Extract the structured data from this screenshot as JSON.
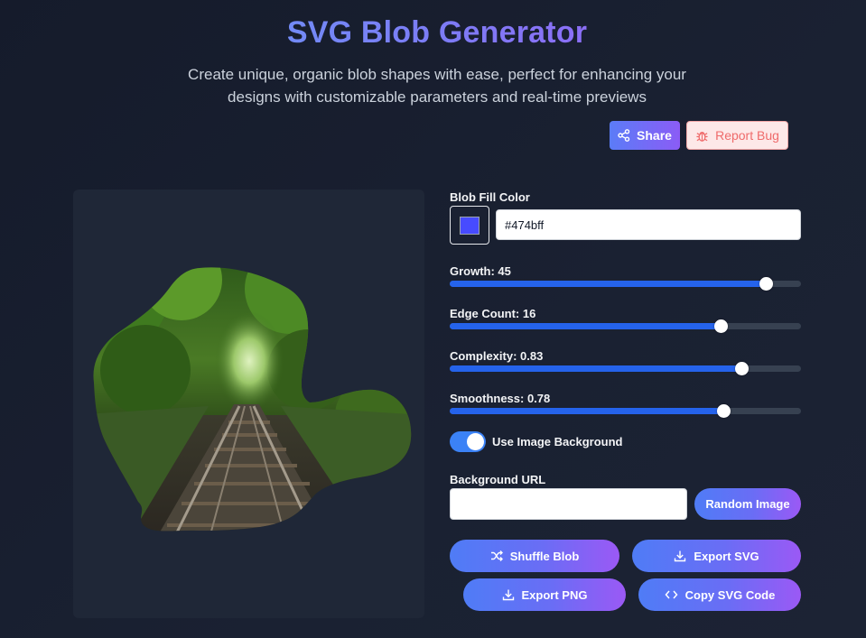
{
  "header": {
    "title": "SVG Blob Generator",
    "subtitle": "Create unique, organic blob shapes with ease, perfect for enhancing your designs with customizable parameters and real-time previews"
  },
  "actions": {
    "share_label": "Share",
    "report_bug_label": "Report Bug"
  },
  "controls": {
    "fill_color_label": "Blob Fill Color",
    "fill_color_value": "#474bff",
    "sliders": [
      {
        "label": "Growth: 45",
        "fraction": 0.9
      },
      {
        "label": "Edge Count: 16",
        "fraction": 0.77
      },
      {
        "label": "Complexity: 0.83",
        "fraction": 0.83
      },
      {
        "label": "Smoothness: 0.78",
        "fraction": 0.78
      }
    ],
    "use_image_label": "Use Image Background",
    "use_image_on": true,
    "background_url_label": "Background URL",
    "background_url_value": "",
    "random_image_label": "Random Image"
  },
  "buttons": {
    "shuffle": "Shuffle Blob",
    "export_svg": "Export SVG",
    "export_png": "Export PNG",
    "copy_svg": "Copy SVG Code"
  },
  "colors": {
    "accent": "#2563eb",
    "blob_fill": "#474bff",
    "gradient_start": "#4f7cf6",
    "gradient_end": "#9b59f5"
  }
}
